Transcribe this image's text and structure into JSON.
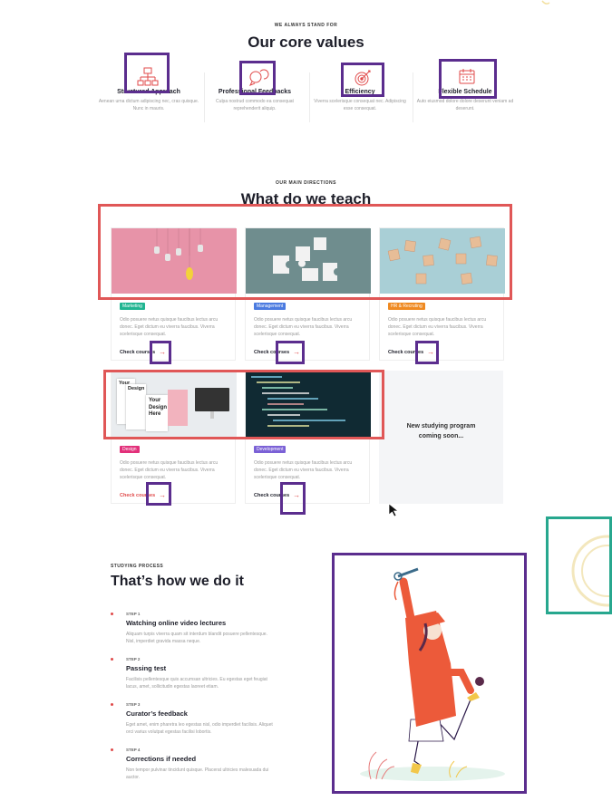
{
  "values_section": {
    "eyebrow": "WE ALWAYS STAND FOR",
    "title": "Our core values",
    "items": [
      {
        "icon": "flowchart-icon",
        "title": "Structured Approach",
        "desc": "Aenean urna dictum adipiscing nec, cras quisque. Nunc in mauris."
      },
      {
        "icon": "chat-bubbles-icon",
        "title": "Professional Feedbacks",
        "desc": "Culpa nostrud commodo ea consequat reprehenderit aliquip."
      },
      {
        "icon": "target-icon",
        "title": "Efficiency",
        "desc": "Viverra scelerisque consequat nec. Adipiscing esse consequat."
      },
      {
        "icon": "calendar-icon",
        "title": "Flexible Schedule",
        "desc": "Auto eiusmod dolore dolore deserunt veniam ad deserunt."
      }
    ]
  },
  "teach_section": {
    "eyebrow": "OUR MAIN DIRECTIONS",
    "title": "What do we teach",
    "cards": [
      {
        "tag": "Marketing",
        "tag_color": "#20b591",
        "desc": "Odio posuere netus quisque faucibus lectus arcu donec. Eget dictum eu viverra faucibus. Viverra scelerisque consequat.",
        "link": "Check courses"
      },
      {
        "tag": "Management",
        "tag_color": "#4b7be0",
        "desc": "Odio posuere netus quisque faucibus lectus arcu donec. Eget dictum eu viverra faucibus. Viverra scelerisque consequat.",
        "link": "Check courses"
      },
      {
        "tag": "HR & Recruting",
        "tag_color": "#ef8a22",
        "desc": "Odio posuere netus quisque faucibus lectus arcu donec. Eget dictum eu viverra faucibus. Viverra scelerisque consequat.",
        "link": "Check courses"
      },
      {
        "tag": "Design",
        "tag_color": "#e2307a",
        "desc": "Odio posuere netus quisque faucibus lectus arcu donec. Eget dictum eu viverra faucibus. Viverra scelerisque consequat.",
        "link": "Check courses"
      },
      {
        "tag": "Development",
        "tag_color": "#7b61d6",
        "desc": "Odio posuere netus quisque faucibus lectus arcu donec. Eget dictum eu viverra faucibus. Viverra scelerisque consequat.",
        "link": "Check courses"
      }
    ],
    "placeholder": "New studying program coming soon...",
    "design_img_text": [
      "Your",
      "Design",
      "Here"
    ]
  },
  "process_section": {
    "eyebrow": "STUDYING PROCESS",
    "title": "That’s how we do it",
    "steps": [
      {
        "num": "STEP 1",
        "title": "Watching online video lectures",
        "desc": "Aliquam turpis viverra quam sit interdum blandit posuere pellentesque. Nisl, imperdiet gravida massa neque."
      },
      {
        "num": "STEP 2",
        "title": "Passing test",
        "desc": "Facilisis pellentesque quis accumsan ultricies. Eu egestas eget feugiat lacus, amet, sollicitudin egestas laoreet etiam."
      },
      {
        "num": "STEP 3",
        "title": "Curator’s feedback",
        "desc": "Eget amet, enim pharetra leo egestas nisl, odio imperdiet facilisis. Aliquet orci varius volutpat egestas facilisi lobortis."
      },
      {
        "num": "STEP 4",
        "title": "Corrections if needed",
        "desc": "Non tempor pulvinar tincidunt quisque. Placerat ultricies malesuada dui auctor."
      }
    ]
  },
  "colors": {
    "accent": "#e04a4a",
    "highlight_purple": "#5b2d8e",
    "highlight_red": "#e05757",
    "highlight_teal": "#27a78e"
  }
}
